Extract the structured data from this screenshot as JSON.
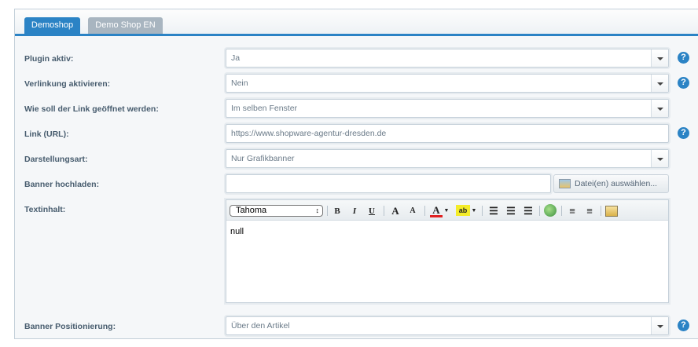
{
  "tabs": [
    {
      "label": "Demoshop",
      "active": true
    },
    {
      "label": "Demo Shop EN",
      "active": false
    }
  ],
  "fields": {
    "plugin_active": {
      "label": "Plugin aktiv:",
      "value": "Ja"
    },
    "link_active": {
      "label": "Verlinkung aktivieren:",
      "value": "Nein"
    },
    "link_target": {
      "label": "Wie soll der Link geöffnet werden:",
      "value": "Im selben Fenster"
    },
    "link_url": {
      "label": "Link (URL):",
      "value": "https://www.shopware-agentur-dresden.de"
    },
    "display_type": {
      "label": "Darstellungsart:",
      "value": "Nur Grafikbanner"
    },
    "banner_upload": {
      "label": "Banner hochladen:",
      "value": "",
      "button_label": "Datei(en) auswählen..."
    },
    "text_content": {
      "label": "Textinhalt:",
      "font": "Tahoma",
      "value": "null"
    },
    "banner_position": {
      "label": "Banner Positionierung:",
      "value": "Über den Artikel"
    }
  },
  "help_symbol": "?",
  "toolbar": {
    "bold": "B",
    "italic": "I",
    "underline": "U",
    "increase_font": "A",
    "decrease_font": "A",
    "font_color": "A",
    "highlight": "ab"
  },
  "colors": {
    "accent": "#2b83c5",
    "tab_inactive": "#a8b5c0",
    "label": "#475c6e"
  }
}
